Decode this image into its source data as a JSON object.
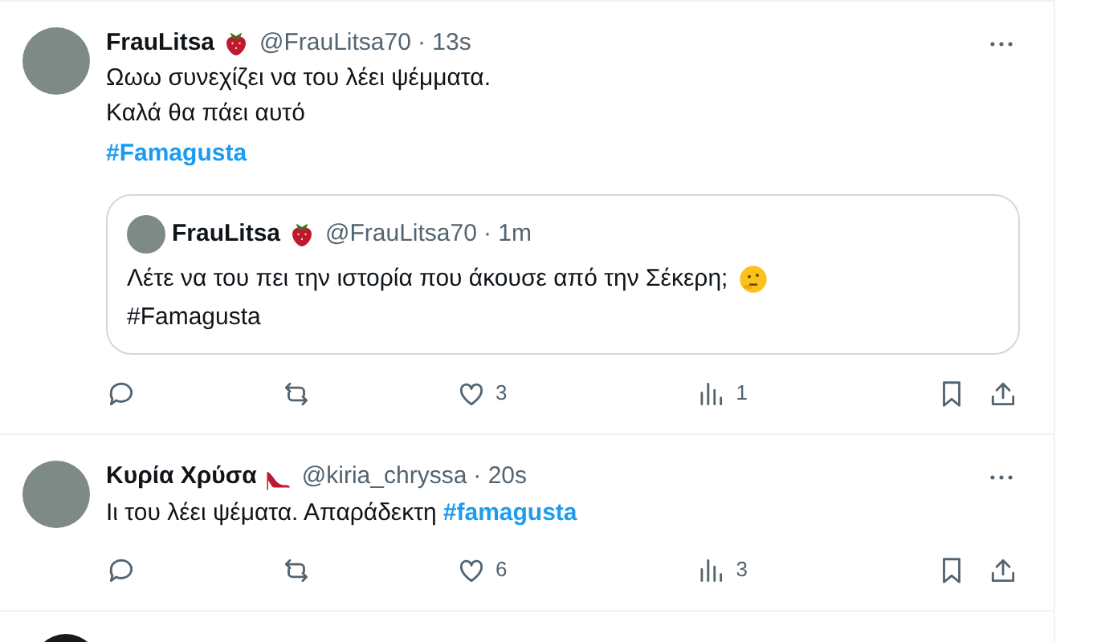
{
  "tweets": [
    {
      "name": "FrauLitsa",
      "handle": "@FrauLitsa70",
      "time": "· 13s",
      "text_lines": [
        "Ωωω συνεχίζει να του λέει ψέμματα.",
        "Καλά θα πάει αυτό"
      ],
      "hashtag": "#Famagusta",
      "kind": "strawberry",
      "quote": {
        "name": "FrauLitsa",
        "handle": "@FrauLitsa70",
        "time": "· 1m",
        "lines": [
          "Λέτε να του πει την ιστορία που άκουσε από την Σέκερη;",
          "#Famagusta"
        ]
      },
      "likes": "3",
      "views": "1"
    },
    {
      "name": "Κυρία Χρύσα",
      "handle": "@kiria_chryssa",
      "time": "· 20s",
      "text": "Ιι του λέει ψέματα. Απαράδεκτη",
      "hashtag": "#famagusta",
      "kind": "heel",
      "likes": "6",
      "views": "3"
    }
  ]
}
